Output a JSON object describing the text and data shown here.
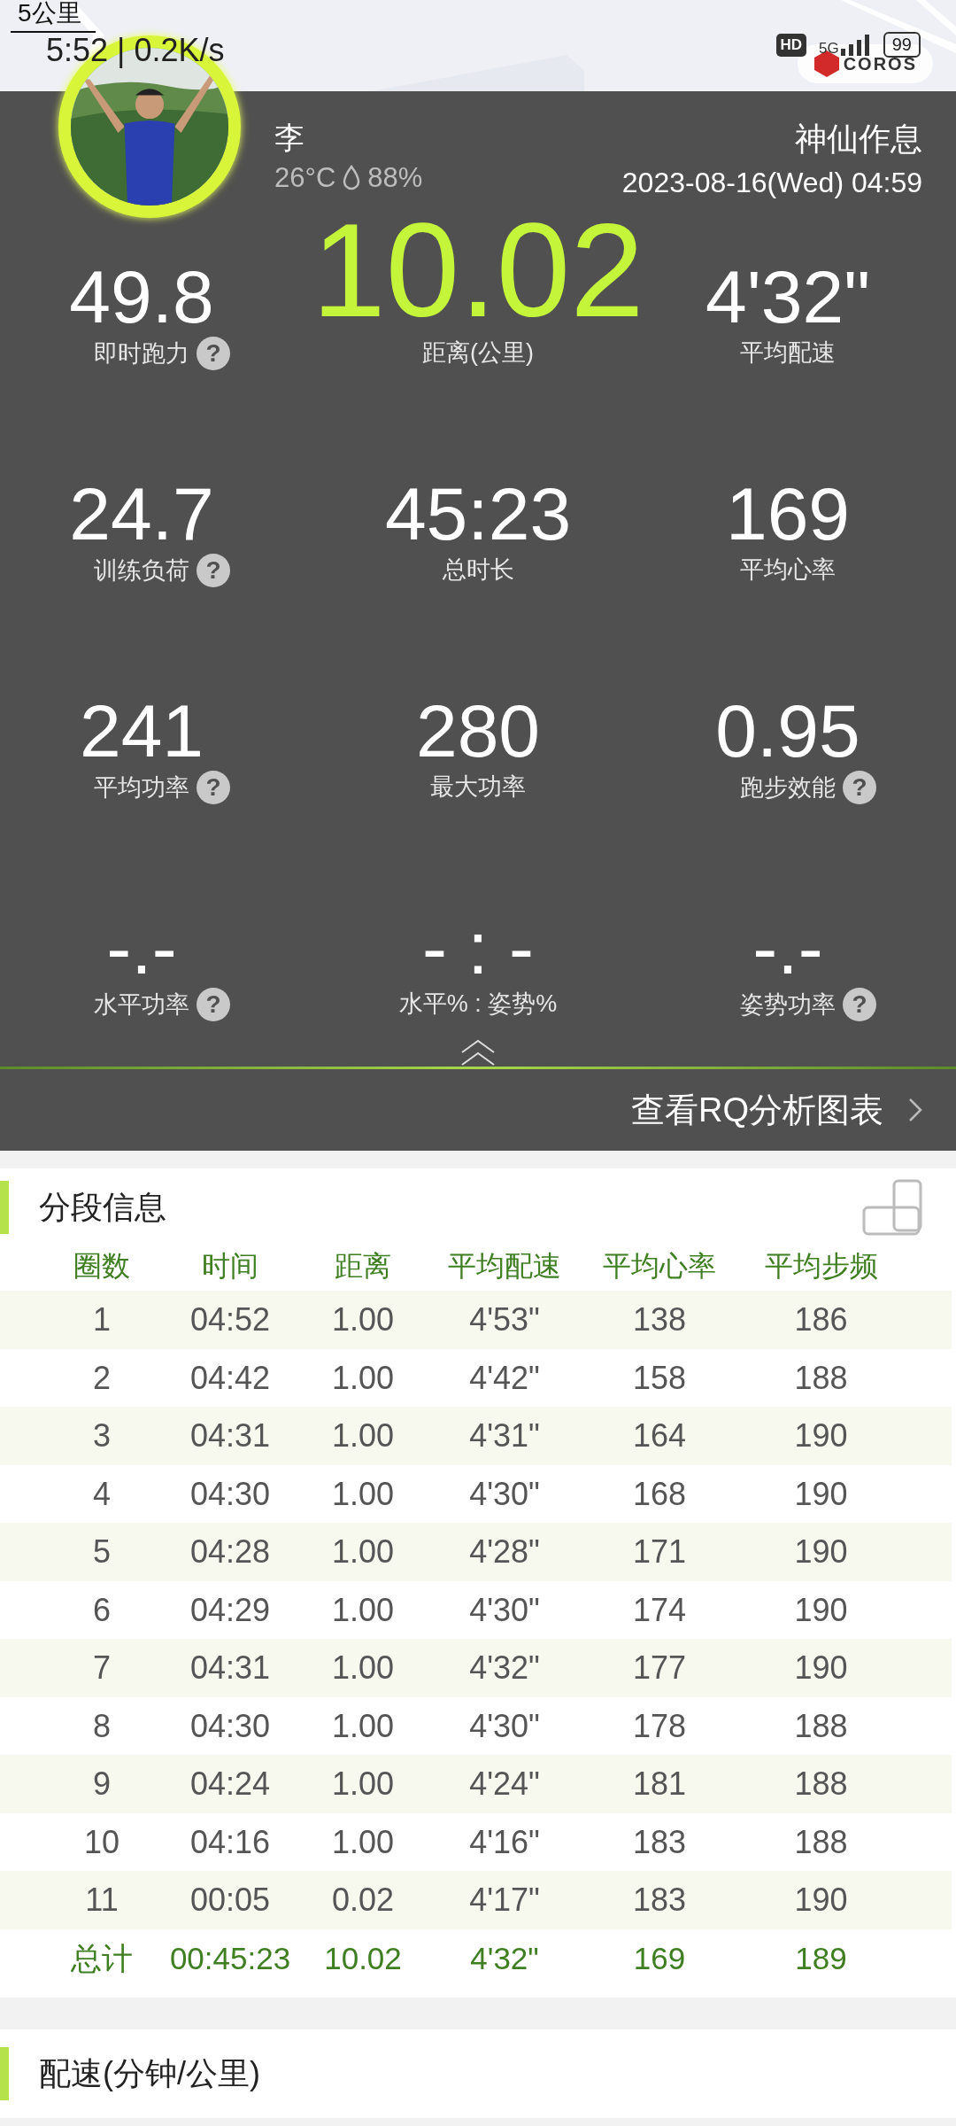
{
  "map": {
    "kind": "picture",
    "scale_label": "5公里"
  },
  "status_bar": {
    "clock_speed": "5:52 | 0.2K/s",
    "hd": "HD",
    "network": "5G",
    "battery": "99",
    "brand": "COROS"
  },
  "header": {
    "name": "李",
    "temperature": "26°C",
    "humidity": "88%",
    "title": "神仙作息",
    "datetime": "2023-08-16(Wed) 04:59"
  },
  "stats": [
    {
      "kind": "normal",
      "value": "49.8",
      "label": "即时跑力",
      "help": "?"
    },
    {
      "kind": "primary",
      "value": "10.02",
      "label": "距离(公里)"
    },
    {
      "kind": "normal",
      "value": "4'32\"",
      "label": "平均配速"
    },
    {
      "kind": "normal",
      "value": "24.7",
      "label": "训练负荷",
      "help": "?"
    },
    {
      "kind": "normal",
      "value": "45:23",
      "label": "总时长"
    },
    {
      "kind": "normal",
      "value": "169",
      "label": "平均心率"
    },
    {
      "kind": "normal",
      "value": "241",
      "label": "平均功率",
      "help": "?"
    },
    {
      "kind": "normal",
      "value": "280",
      "label": "最大功率"
    },
    {
      "kind": "normal",
      "value": "0.95",
      "label": "跑步效能",
      "help": "?"
    },
    {
      "kind": "normal",
      "value": "-.-",
      "label": "水平功率",
      "help": "?"
    },
    {
      "kind": "normal",
      "value": "- : -",
      "label": "水平% : 姿势%"
    },
    {
      "kind": "normal",
      "value": "-.-",
      "label": "姿势功率",
      "help": "?"
    }
  ],
  "rq_link": {
    "label": "查看RQ分析图表"
  },
  "laps": {
    "title": "分段信息",
    "columns": [
      "圈数",
      "时间",
      "距离",
      "平均配速",
      "平均心率",
      "平均步频"
    ],
    "rows": [
      [
        "1",
        "04:52",
        "1.00",
        "4'53\"",
        "138",
        "186"
      ],
      [
        "2",
        "04:42",
        "1.00",
        "4'42\"",
        "158",
        "188"
      ],
      [
        "3",
        "04:31",
        "1.00",
        "4'31\"",
        "164",
        "190"
      ],
      [
        "4",
        "04:30",
        "1.00",
        "4'30\"",
        "168",
        "190"
      ],
      [
        "5",
        "04:28",
        "1.00",
        "4'28\"",
        "171",
        "190"
      ],
      [
        "6",
        "04:29",
        "1.00",
        "4'30\"",
        "174",
        "190"
      ],
      [
        "7",
        "04:31",
        "1.00",
        "4'32\"",
        "177",
        "190"
      ],
      [
        "8",
        "04:30",
        "1.00",
        "4'30\"",
        "178",
        "188"
      ],
      [
        "9",
        "04:24",
        "1.00",
        "4'24\"",
        "181",
        "188"
      ],
      [
        "10",
        "04:16",
        "1.00",
        "4'16\"",
        "183",
        "188"
      ],
      [
        "11",
        "00:05",
        "0.02",
        "4'17\"",
        "183",
        "190"
      ]
    ],
    "total": [
      "总计",
      "00:45:23",
      "10.02",
      "4'32\"",
      "169",
      "189"
    ]
  },
  "pace_section": {
    "title": "配速(分钟/公里)"
  }
}
